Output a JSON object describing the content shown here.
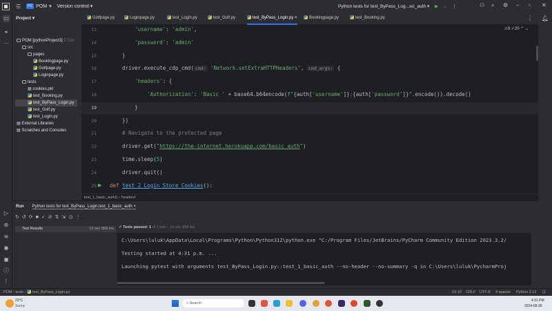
{
  "titlebar": {
    "project": "POM",
    "project_badge": "PC",
    "vcs": "Version control ▾",
    "run_config": "Python tests for test_ByPass_Log...sic_auth ▾"
  },
  "project_panel": {
    "title": "Project ▾",
    "items": [
      {
        "label": "POM [pythonProject3]",
        "suffix": "C:\\Us",
        "type": "folder",
        "depth": 0
      },
      {
        "label": "src",
        "type": "folder",
        "depth": 1
      },
      {
        "label": "pages",
        "type": "folder",
        "depth": 2
      },
      {
        "label": "Bookingpage.py",
        "type": "py",
        "depth": 3
      },
      {
        "label": "Golfpage.py",
        "type": "py",
        "depth": 3
      },
      {
        "label": "Loginpage.py",
        "type": "py",
        "depth": 3
      },
      {
        "label": "tests",
        "type": "folder",
        "depth": 1
      },
      {
        "label": "cookies.pkl",
        "type": "file",
        "depth": 2
      },
      {
        "label": "test_Booking.py",
        "type": "py",
        "depth": 2
      },
      {
        "label": "test_ByPass_Login.py",
        "type": "py",
        "depth": 2,
        "selected": true
      },
      {
        "label": "test_Golf.py",
        "type": "py",
        "depth": 2
      },
      {
        "label": "test_Login.py",
        "type": "py",
        "depth": 2
      },
      {
        "label": "External Libraries",
        "type": "lib",
        "depth": 0
      },
      {
        "label": "Scratches and Consoles",
        "type": "lib",
        "depth": 0
      }
    ]
  },
  "tabs": [
    {
      "label": "Golfpage.py"
    },
    {
      "label": "Loginpage.py"
    },
    {
      "label": "test_Login.py"
    },
    {
      "label": "test_Golf.py"
    },
    {
      "label": "test_ByPass_Login.py",
      "active": true
    },
    {
      "label": "Bookingpage.py"
    },
    {
      "label": "test_Booking.py"
    }
  ],
  "editor": {
    "inspections": "⚠9 ✓20 ⌃ ⌄",
    "current_line": 19,
    "lines": [
      {
        "n": "13",
        "seg": [
          [
            "        ",
            ""
          ],
          [
            "'username'",
            "s"
          ],
          [
            ": ",
            ""
          ],
          [
            "'admin'",
            "s"
          ],
          [
            ",",
            ""
          ]
        ]
      },
      {
        "n": "14",
        "seg": [
          [
            "        ",
            ""
          ],
          [
            "'password'",
            "s"
          ],
          [
            ": ",
            ""
          ],
          [
            "'admin'",
            "s"
          ]
        ]
      },
      {
        "n": "15",
        "seg": [
          [
            "    }",
            ""
          ]
        ]
      },
      {
        "n": "16",
        "seg": [
          [
            "    driver.execute_cdp_cmd(",
            ""
          ],
          [
            "cmd:",
            "hint"
          ],
          [
            " ",
            ""
          ],
          [
            "'Network.setExtraHTTPHeaders'",
            "s"
          ],
          [
            ", ",
            ""
          ],
          [
            "cmd_args:",
            "hint"
          ],
          [
            " {",
            ""
          ]
        ]
      },
      {
        "n": "17",
        "seg": [
          [
            "        ",
            ""
          ],
          [
            "'headers'",
            "s"
          ],
          [
            ": {",
            ""
          ]
        ]
      },
      {
        "n": "18",
        "seg": [
          [
            "            ",
            ""
          ],
          [
            "'Authorization'",
            "s"
          ],
          [
            ": ",
            ""
          ],
          [
            "'Basic '",
            "s"
          ],
          [
            " + base64.b64encode(",
            ""
          ],
          [
            "f\"",
            "s"
          ],
          [
            "{auth[",
            ""
          ],
          [
            "'username'",
            "s"
          ],
          [
            "]}",
            ""
          ],
          [
            ":",
            "s"
          ],
          [
            "{auth[",
            ""
          ],
          [
            "'password'",
            "s"
          ],
          [
            "]}",
            ""
          ],
          [
            "\"",
            "s"
          ],
          [
            ".encode()).decode()",
            ""
          ]
        ]
      },
      {
        "n": "19",
        "seg": [
          [
            "        }",
            ""
          ]
        ]
      },
      {
        "n": "20",
        "seg": [
          [
            "    })",
            ""
          ]
        ]
      },
      {
        "n": "21",
        "seg": [
          [
            "    # Navigate to the protected page",
            "c"
          ]
        ]
      },
      {
        "n": "22",
        "seg": [
          [
            "    driver.get(",
            ""
          ],
          [
            "\"",
            "s"
          ],
          [
            "https://the-internet.herokuapp.com/basic_auth",
            "u"
          ],
          [
            "\"",
            "s"
          ],
          [
            ")",
            ""
          ]
        ]
      },
      {
        "n": "23",
        "seg": [
          [
            "    time.sleep(",
            ""
          ],
          [
            "5",
            "n"
          ],
          [
            ")",
            ""
          ]
        ]
      },
      {
        "n": "24",
        "seg": [
          [
            "    driver.quit()",
            ""
          ]
        ]
      },
      {
        "n": "25",
        "seg": [
          [
            "def ",
            "k"
          ],
          [
            "test_2_Login_Store_Cookies",
            "f"
          ],
          [
            "():",
            ""
          ]
        ]
      }
    ]
  },
  "breadcrumb": "test_1_basic_auth()  ›  'headers'",
  "run": {
    "tab_run": "Run",
    "tab_config": "Python tests for test_ByPass_Login.test_1_basic_auth  ×",
    "test_results": "Test Results",
    "test_time": "13 sec 958 ms",
    "passed_label": "✓ Tests passed: 1",
    "passed_detail": "of 1 test – 13 sec 958 ms",
    "console": [
      "C:\\Users\\luluk\\AppData\\Local\\Programs\\Python\\Python312\\python.exe \"C:/Program Files/JetBrains/PyCharm Community Edition 2023.3.2/",
      "Testing started at 4:31 p.m. ...",
      "Launching pytest with arguments test_ByPass_Login.py::test_1_basic_auth --no-header --no-summary -q in C:\\Users\\luluk\\PycharmProj"
    ]
  },
  "status": {
    "path": [
      "POM",
      "tests",
      "test_ByPass_Login.py"
    ],
    "position": "19:10",
    "line_sep": "CRLF",
    "encoding": "UTF-8",
    "indent": "4 spaces",
    "interpreter": "Python 3.12"
  },
  "taskbar": {
    "weather_temp": "23°C",
    "weather_desc": "Sunny",
    "search": "Search",
    "time": "4:31 PM",
    "date": "2024-08-30"
  }
}
